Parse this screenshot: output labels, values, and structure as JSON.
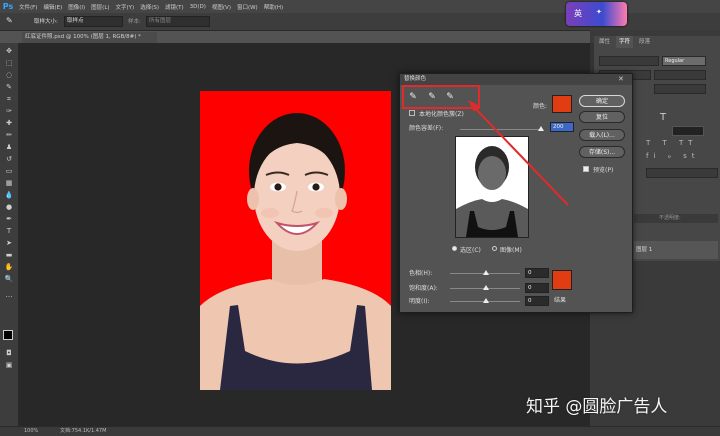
{
  "app": {
    "logo": "Ps"
  },
  "menu": [
    "文件(F)",
    "编辑(E)",
    "图像(I)",
    "图层(L)",
    "文字(Y)",
    "选择(S)",
    "滤镜(T)",
    "3D(D)",
    "视图(V)",
    "窗口(W)",
    "帮助(H)"
  ],
  "options": {
    "brush_size_label": "取样大小:",
    "brush_size_value": "取样点",
    "sample_label": "样本:",
    "sample_value": "所有图层"
  },
  "ime": {
    "label": "英"
  },
  "document": {
    "tab_title": "红底证件照.psd @ 100% (图层 1, RGB/8#) *",
    "zoom": "100%",
    "doc_info": "文档:754.1K/1.47M"
  },
  "panels": {
    "tabs": [
      "属性",
      "字符",
      "段落"
    ],
    "font_style": "Regular",
    "layer_name": "图层 1",
    "layer_tag": "不透明度:"
  },
  "dialog": {
    "title": "替换颜色",
    "ok_label": "确定",
    "reset_label": "复位",
    "load_label": "载入(L)...",
    "save_label": "存储(S)...",
    "preview_label": "预览(P)",
    "localized_label": "本地化颜色簇(Z)",
    "color_label": "颜色:",
    "fuzziness_label": "颜色容差(F):",
    "fuzziness_value": "200",
    "selection_label": "选区(C)",
    "image_label": "图像(M)",
    "hue_label": "色相(H):",
    "hue_value": "0",
    "saturation_label": "饱和度(A):",
    "saturation_value": "0",
    "lightness_label": "明度(I):",
    "lightness_value": "0",
    "result_label": "结果",
    "selected_color": "#e13c12"
  },
  "watermark": "知乎 @圆脸广告人",
  "colors": {
    "background_red": "#ff0000",
    "highlight": "#e02b2b"
  }
}
